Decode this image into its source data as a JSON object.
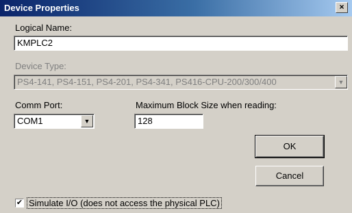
{
  "window": {
    "title": "Device Properties",
    "close_glyph": "×"
  },
  "logical_name": {
    "label": "Logical Name:",
    "value": "KMPLC2"
  },
  "device_type": {
    "label": "Device Type:",
    "value": "PS4-141, PS4-151, PS4-201, PS4-341, PS416-CPU-200/300/400"
  },
  "comm_port": {
    "label": "Comm Port:",
    "value": "COM1"
  },
  "max_block_size": {
    "label": "Maximum Block Size when reading:",
    "value": "128"
  },
  "buttons": {
    "ok": "OK",
    "cancel": "Cancel"
  },
  "simulate": {
    "label": "Simulate I/O (does not access the physical PLC)",
    "checked": true,
    "check_glyph": "✔"
  },
  "icons": {
    "dropdown": "chevron-down-icon",
    "close": "close-icon"
  }
}
